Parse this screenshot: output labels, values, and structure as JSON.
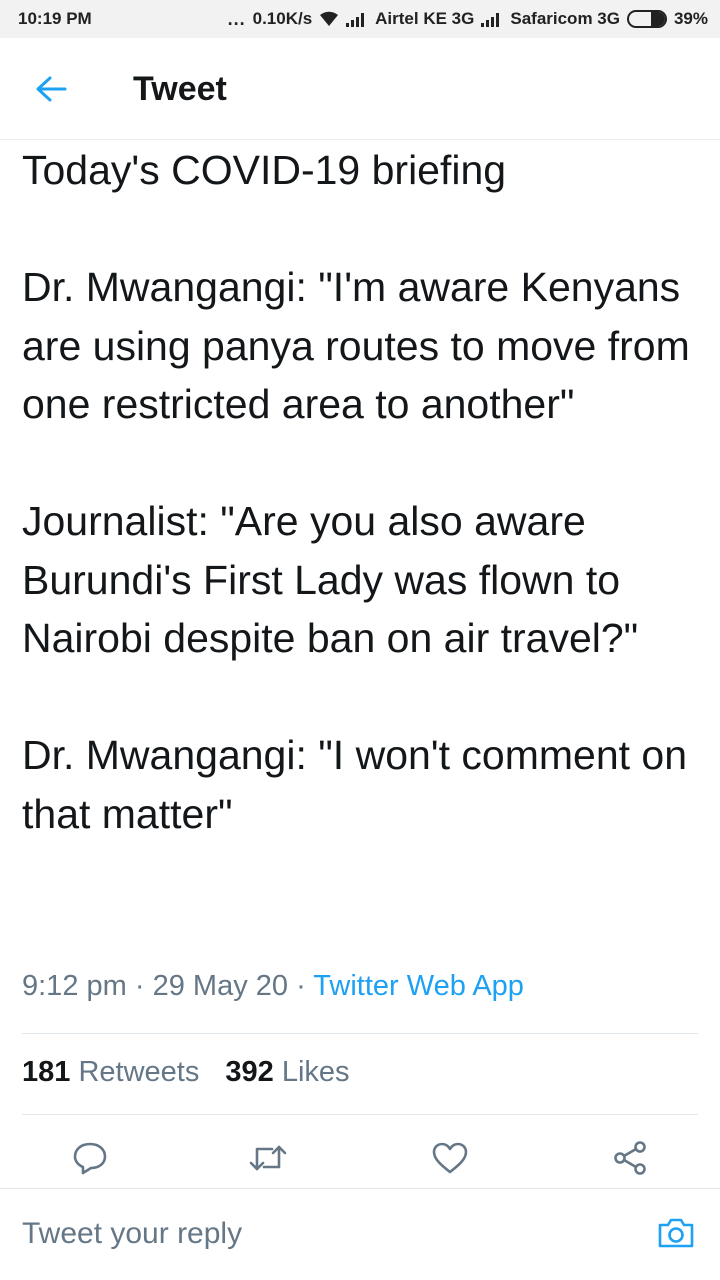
{
  "status_bar": {
    "time": "10:19 PM",
    "dots": "...",
    "speed": "0.10K/s",
    "carrier1": "Airtel KE 3G",
    "carrier2": "Safaricom 3G",
    "battery_percent_text": "39%",
    "battery_level": 0.39
  },
  "header": {
    "title": "Tweet",
    "back_icon": "back-arrow-icon"
  },
  "tweet": {
    "paragraphs": [
      "Today's COVID-19 briefing",
      "Dr. Mwangangi: \"I'm aware Kenyans are using panya routes to move from one restricted area to another\"",
      "Journalist: \"Are you also aware Burundi's First Lady was flown to Nairobi despite ban on air travel?\"",
      "Dr. Mwangangi: \"I won't comment on that matter\""
    ],
    "time": "9:12 pm",
    "separator": "·",
    "date": "29 May 20",
    "source": "Twitter Web App"
  },
  "stats": {
    "retweets_count": "181",
    "retweets_label": "Retweets",
    "likes_count": "392",
    "likes_label": "Likes"
  },
  "actions": [
    "reply-icon",
    "retweet-icon",
    "like-icon",
    "share-icon"
  ],
  "reply": {
    "placeholder": "Tweet your reply",
    "camera_icon": "camera-icon"
  },
  "colors": {
    "accent": "#1da1f2",
    "secondary_text": "#657786",
    "primary_text": "#14171a"
  }
}
